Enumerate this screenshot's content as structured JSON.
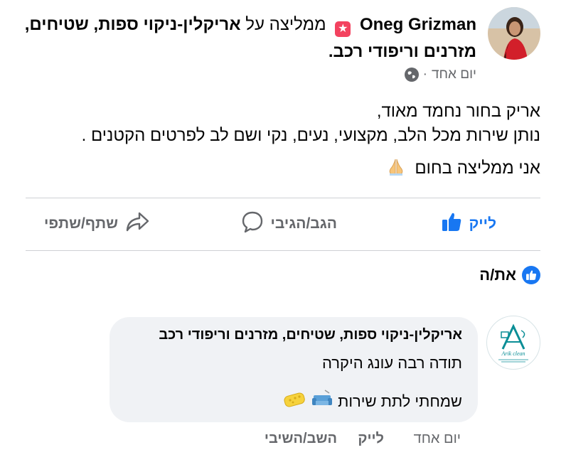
{
  "post": {
    "author": "Oneg Grizman",
    "action_text": "ממליצה על",
    "page_name": "אריקלין-ניקוי ספות, שטיחים, מזרנים וריפודי רכב.",
    "time": "יום אחד",
    "time_sep": "·",
    "body": {
      "line1": "אריק בחור נחמד מאוד,",
      "line2": "נותן שירות מכל הלב, מקצועי, נעים, נקי ושם לב לפרטים הקטנים .",
      "line3": "אני ממליצה בחום"
    }
  },
  "actions": {
    "like": "לייק",
    "comment": "הגב/הגיבי",
    "share": "שתף/שתפי"
  },
  "you_label": "את/ה",
  "comment": {
    "author": "אריקלין-ניקוי ספות, שטיחים, מזרנים וריפודי רכב",
    "line1": "תודה רבה עונג היקרה",
    "line2": "שמחתי לתת שירות",
    "logo_text": "Arik clean",
    "time": "יום אחד",
    "like": "לייק",
    "reply": "השב/השיבי"
  },
  "colors": {
    "accent": "#1877f2",
    "muted": "#65676b",
    "recommend": "#f3425f",
    "logo": "#0a8e96"
  }
}
